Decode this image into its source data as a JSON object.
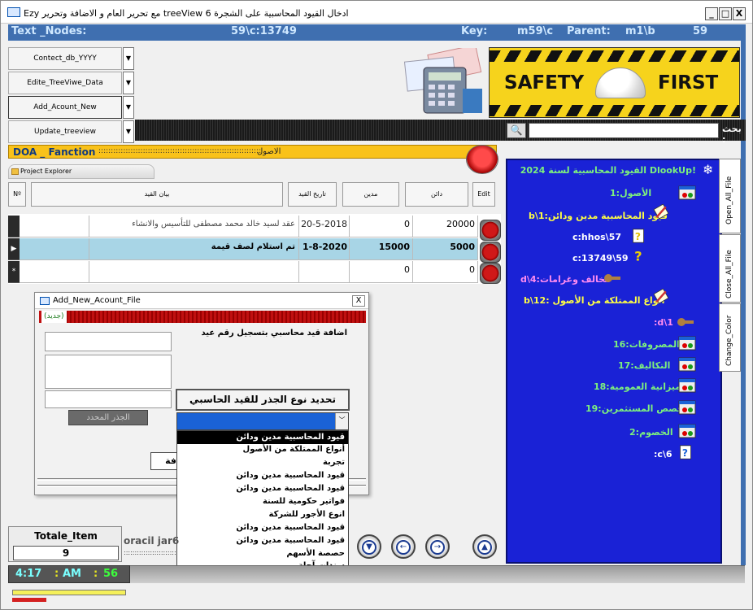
{
  "window": {
    "title": "Ezy مع تحرير العام و الاضافة وتحرير treeView 6 ادخال القيود المحاسبية على الشجرة",
    "buttons": [
      "_",
      "□",
      "X"
    ]
  },
  "nodebar": {
    "text_nodes_label": "Text _Nodes:",
    "text_nodes_value": "59\\c:13749",
    "key_label": "Key:",
    "key_value": "m59\\c",
    "parent_label": "Parent:",
    "parent_value": "m1\\b",
    "parent_num": "59"
  },
  "nav_buttons": [
    {
      "label": "Contect_db_YYYY",
      "active": false
    },
    {
      "label": "Edite_TreeViwe_Data",
      "active": false
    },
    {
      "label": "Add_Acount_New",
      "active": true
    },
    {
      "label": "Update_treeview",
      "active": false
    }
  ],
  "banner": {
    "word1": "SAFETY",
    "word2": "FIRST"
  },
  "search": {
    "label": "بحث :",
    "value": ""
  },
  "doa": {
    "title": "DOA _ Fanction",
    "dots": ":::::::::::::::::::::::::::::::::::::::::::::::::::::::::::::::::::::",
    "label": "الاصول"
  },
  "project_explorer": {
    "label": "Project Explorer"
  },
  "grid_headers": {
    "no": "Nº",
    "description": "بيان القيد",
    "date": "تاريخ القيد",
    "debit": "مدين",
    "credit": "دائن",
    "edit": "Edit"
  },
  "grid_rows": [
    {
      "selector": "",
      "description": "عقد لسيد خالد محمد مصطفى للتأسيس والانشاء",
      "date": "20-5-2018",
      "debit": "0",
      "credit": "20000",
      "selected": false
    },
    {
      "selector": "▶",
      "description": "تم استلام لصف قيمة",
      "date": "1-8-2020",
      "debit": "15000",
      "credit": "5000",
      "selected": true
    },
    {
      "selector": "*",
      "description": "",
      "date": "",
      "debit": "0",
      "credit": "0",
      "selected": false
    }
  ],
  "tree": {
    "root": "القيود المحاسبية لسنة 2024 DlookUp!",
    "nodes": [
      {
        "label": "1:الأصول",
        "color": "#7df07d"
      },
      {
        "label": "b\\1:قيود المحاسبية مدين ودائن",
        "color": "#ffff44"
      },
      {
        "label": "c:hhos\\57",
        "color": "#ffffff"
      },
      {
        "label": "c:13749\\59",
        "color": "#ffffff"
      },
      {
        "label": "d\\4:مخالف وغرامات",
        "color": "#ff8cf0"
      },
      {
        "label": "b\\12: أنواع الممتلكة من الأصول",
        "color": "#ffff44"
      },
      {
        "label": ":d\\1",
        "color": "#ff8cf0"
      },
      {
        "label": "16:المصروفات",
        "color": "#7df07d"
      },
      {
        "label": "17:التكاليف",
        "color": "#7df07d"
      },
      {
        "label": "18:ميزانية العمومية",
        "color": "#7df07d"
      },
      {
        "label": "19:حصص المستثمرين",
        "color": "#7df07d"
      },
      {
        "label": "2:الخصوم",
        "color": "#7df07d"
      },
      {
        "label": ":c\\6",
        "color": "#ffffff"
      }
    ]
  },
  "side_tabs": [
    "Open_All_File",
    "Close_All_File",
    "Change_Color"
  ],
  "dialog": {
    "title": "Add_New_Acount_File",
    "close": "X",
    "new_label": "(جديد)",
    "instruction": "اضافة قيد محاسبي بتسجيل رقم عيد",
    "root_button": "الجذر المحدد",
    "choose_label": "تحديد نوع الجذر للقيد الحاسبي",
    "save_label": "فة"
  },
  "dropdown_items": [
    "قيود المحاسبية مدين ودائن",
    "أنواع الممتلكة من الأصول",
    "تجربة",
    "قيود المحاسبية مدين ودائن",
    "قيود المحاسبية مدين ودائن",
    "فواتير حكومية للسنة",
    "انوع الأجور للشركة",
    "قيود المحاسبية مدين ودائن",
    "قيود المحاسبية مدين ودائن",
    "حصصة الأسهم",
    "سندات آجلة"
  ],
  "totale": {
    "label": "Totale_Item",
    "value": "9"
  },
  "oracil": {
    "label": "oracil jar6",
    "dots": "::::::::::::::::::::::::::::::::"
  },
  "clock": {
    "time": "4:17",
    "ampm": "AM",
    "seconds": "56",
    "sep1": ":",
    "sep2": ":"
  },
  "colors": {
    "accent": "#3f6fb0",
    "tree_bg": "#1a22d6",
    "banner": "#f6d31c",
    "doa_bar": "#f9c21a"
  },
  "icons": {
    "window": "window-icon",
    "search": "magnifier-icon",
    "folder": "folder-icon"
  }
}
